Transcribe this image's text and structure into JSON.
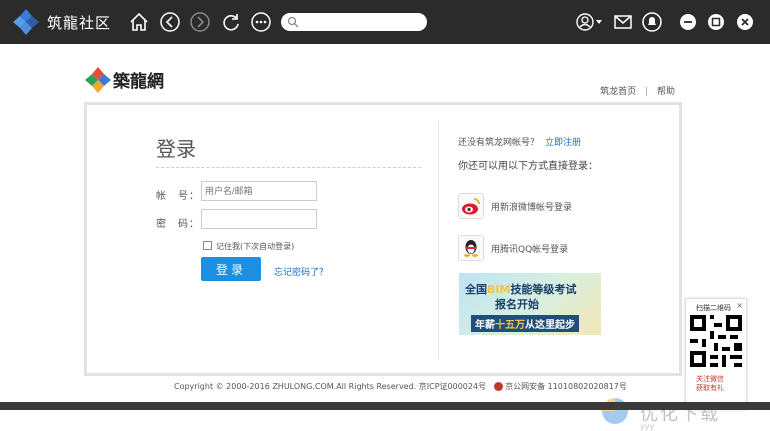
{
  "app": {
    "title": "筑龍社区",
    "search_placeholder": ""
  },
  "site": {
    "name": "築龍網",
    "links": [
      "筑龙首页",
      "帮助"
    ],
    "link_sep": "|"
  },
  "login": {
    "title": "登录",
    "username_label": "帐　号：",
    "username_placeholder": "用户名/邮箱",
    "password_label": "密　码：",
    "remember_label": "记住我(下次自动登录)",
    "submit_label": "登录",
    "forgot_label": "忘记密码了？"
  },
  "side": {
    "no_account": "还没有筑龙网帐号？",
    "register": "立即注册",
    "also_text": "你还可以用以下方式直接登录：",
    "weibo": "用新浪微博帐号登录",
    "qq": "用腾讯QQ帐号登录"
  },
  "banner": {
    "line1_pre": "全国",
    "line1_hl": "BIM",
    "line1_post": "技能等级考试",
    "line2": "报名开始",
    "line3_pre": "年薪",
    "line3_hl": "十五万",
    "line3_post": "从这里起步"
  },
  "footer": {
    "copyright": "Copyright © 2000-2016 ZHULONG.COM.All Rights Reserved. 京ICP证000024号",
    "police": "京公网安备 11010802020817号"
  },
  "qr": {
    "title": "扫描二维码",
    "close": "×",
    "foot1": "关注微信",
    "foot2": "获取有礼"
  },
  "watermark": {
    "text": "优化下载",
    "sub": "yyy"
  },
  "colors": {
    "titlebar": "#2b2b2b",
    "accent": "#1c8fe0",
    "link": "#1a6fc4"
  }
}
